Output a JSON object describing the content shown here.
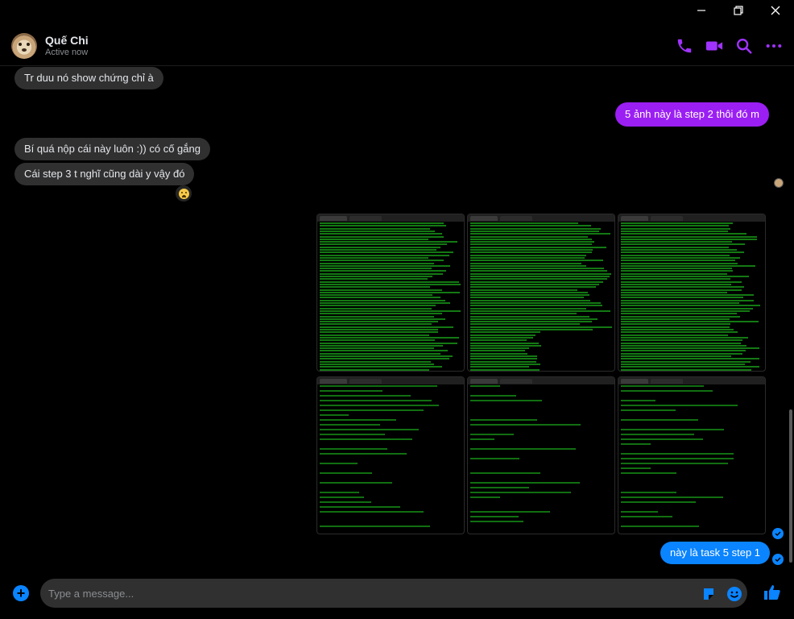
{
  "window": {
    "minimize": "minimize",
    "restore": "restore",
    "close": "close"
  },
  "contact": {
    "name": "Quế Chi",
    "status": "Active now"
  },
  "header_icons": [
    "phone-icon",
    "video-icon",
    "search-icon",
    "more-icon"
  ],
  "messages": [
    {
      "text": "Tr duu nó show chứng chỉ à",
      "from": "in"
    },
    {
      "text": "5 ảnh này là step 2 thôi đó m",
      "from": "out"
    },
    {
      "text": "Bí quá nộp cái này luôn :)) có cố gắng",
      "from": "in"
    },
    {
      "text": "Cái step 3 t nghĩ cũng dài y vậy đó",
      "from": "in"
    },
    {
      "text": "này là task 5 step 1",
      "from": "out"
    }
  ],
  "reaction": "😰",
  "screenshot_grid": {
    "rows": 2,
    "columns": 3,
    "theme": "terminal-green"
  },
  "composer": {
    "placeholder": "Type a message..."
  },
  "colors": {
    "accent": "#a033ff",
    "outgoing_purple": "#9b1ff3",
    "outgoing_blue": "#0a84ff",
    "incoming": "#303030",
    "terminal_text": "#22dd22"
  }
}
